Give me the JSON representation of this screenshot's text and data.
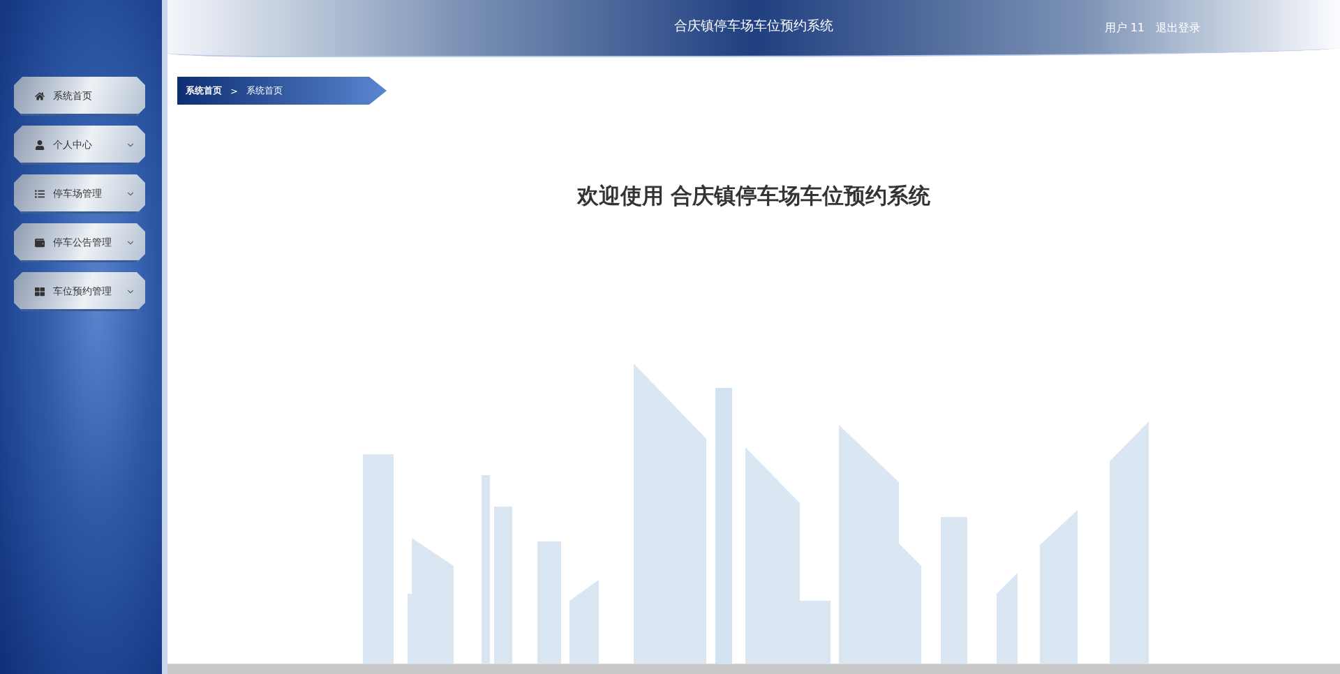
{
  "header": {
    "title": "合庆镇停车场车位预约系统",
    "user": "用户 11",
    "logout": "退出登录"
  },
  "sidebar": {
    "items": [
      {
        "label": "系统首页",
        "expandable": false
      },
      {
        "label": "个人中心",
        "expandable": true
      },
      {
        "label": "停车场管理",
        "expandable": true
      },
      {
        "label": "停车公告管理",
        "expandable": true
      },
      {
        "label": "车位预约管理",
        "expandable": true
      }
    ]
  },
  "breadcrumb": [
    "系统首页",
    "系统首页"
  ],
  "breadcrumb_separator": ">",
  "welcome": "欢迎使用 合庆镇停车场车位预约系统"
}
